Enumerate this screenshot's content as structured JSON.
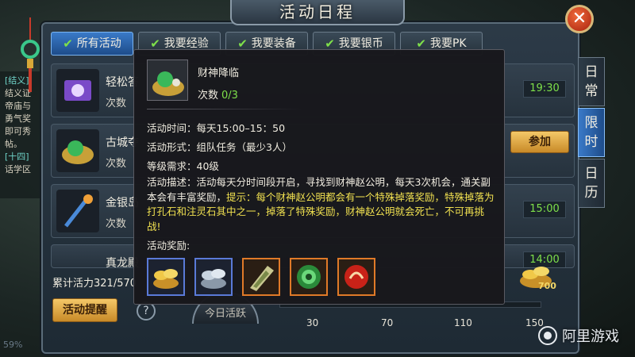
{
  "title": "活动日程",
  "tabs": [
    {
      "label": "所有活动",
      "active": true
    },
    {
      "label": "我要经验",
      "active": false
    },
    {
      "label": "我要装备",
      "active": false
    },
    {
      "label": "我要银币",
      "active": false
    },
    {
      "label": "我要PK",
      "active": false
    }
  ],
  "side_tabs": [
    {
      "chars": [
        "日",
        "常"
      ],
      "active": false
    },
    {
      "chars": [
        "限",
        "时"
      ],
      "active": true
    },
    {
      "chars": [
        "日",
        "历"
      ],
      "active": false
    }
  ],
  "activities": [
    {
      "name": "轻松答",
      "count_label": "次数",
      "time": "19:30"
    },
    {
      "name": "古城夺",
      "count_label": "次数",
      "action": "参加"
    },
    {
      "name": "金银岛",
      "count_label": "次数",
      "time": "15:00"
    },
    {
      "name": "真龙殿",
      "count_label": "",
      "time": "14:00"
    }
  ],
  "left_chat": {
    "l1": "[结义]",
    "l2": "结义证",
    "l3": "帝庙与",
    "l4": "勇气奖",
    "l5": "即可秀",
    "l6": "帖。",
    "l7": "[十四]",
    "l8": "话学区"
  },
  "vitality": {
    "label": "累计活力321/570"
  },
  "remind_button": "活动提醒",
  "help_icon": "?",
  "today_button": "今日活跃",
  "progress": {
    "current": 321,
    "max": 150
  },
  "milestones": [
    "30",
    "70",
    "110",
    "150"
  ],
  "treasure_value": "700",
  "percent_text": "59%",
  "watermark": "阿里游戏",
  "popup": {
    "name": "财神降临",
    "count_label": "次数",
    "count_value": "0/3",
    "time": "活动时间：每天15:00–15：50",
    "form": "活动形式：组队任务（最少3人）",
    "level": "等级需求：40级",
    "desc_white": "活动描述：活动每天分时间段开启，寻找到财神赵公明，每天3次机会，通关副本会有丰富奖励，",
    "desc_yellow": "提示：每个财神赵公明都会有一个特殊掉落奖励，特殊掉落为打孔石和注灵石其中之一，掉落了特殊奖励，财神赵公明就会死亡，不可再挑战!",
    "rewards_label": "活动奖励:",
    "rewards": [
      "gold-coins",
      "silver-coins",
      "hole-stone",
      "jade-orb",
      "red-orb"
    ]
  }
}
